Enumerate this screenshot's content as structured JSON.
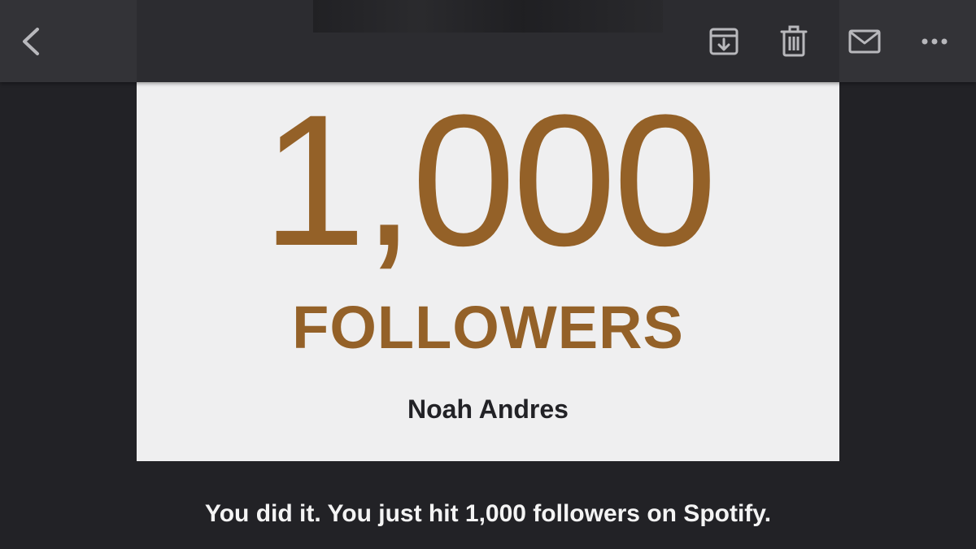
{
  "toolbar": {
    "icons": {
      "back": "chevron-left-icon",
      "archive": "archive-icon",
      "trash": "trash-icon",
      "mail": "mail-icon",
      "more": "more-icon"
    },
    "icon_color": "#b8b8bc"
  },
  "card": {
    "count": "1,000",
    "label": "FOLLOWERS",
    "artist": "Noah Andres",
    "accent_color": "#946128",
    "background_color": "#efeff0"
  },
  "body": {
    "message": "You did it. You just hit 1,000 followers on Spotify."
  },
  "colors": {
    "toolbar_background": "#333337",
    "page_background": "#222226"
  }
}
